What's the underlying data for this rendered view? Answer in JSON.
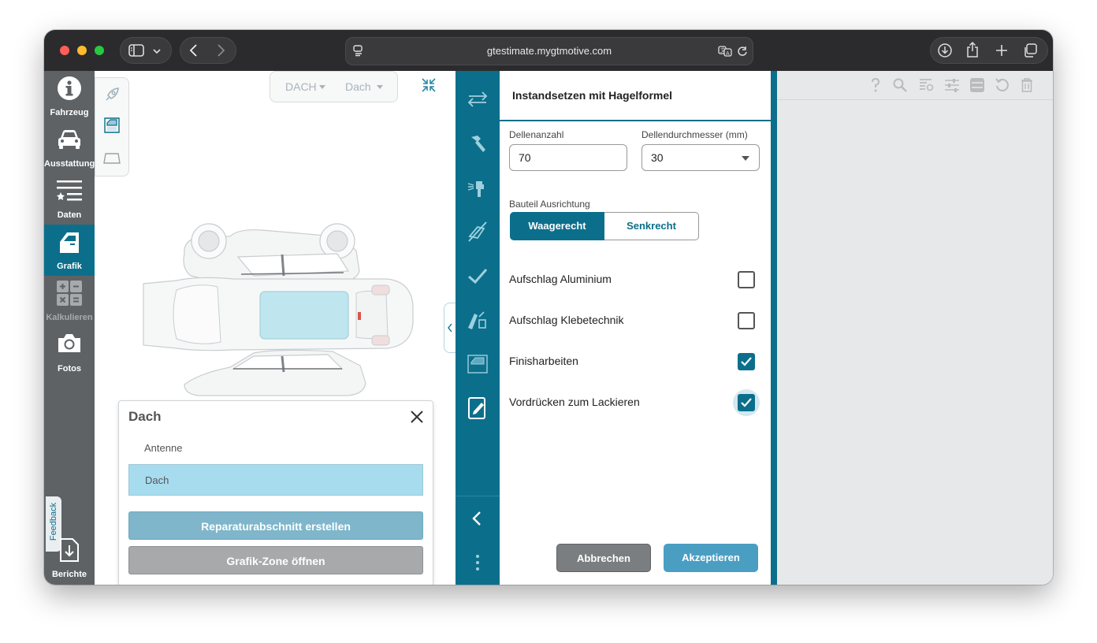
{
  "browser": {
    "url": "gtestimate.mygtmotive.com",
    "icons": [
      "sidebar-icon",
      "chevron-down-icon",
      "back-icon",
      "forward-icon",
      "site-settings-icon",
      "translate-icon",
      "reload-icon",
      "download-icon",
      "share-icon",
      "new-tab-icon",
      "tabs-overview-icon"
    ]
  },
  "left_sidebar": {
    "items": [
      {
        "label": "Fahrzeug",
        "icon": "info-icon"
      },
      {
        "label": "Ausstattung",
        "icon": "car-icon"
      },
      {
        "label": "Daten",
        "icon": "list-star-icon"
      },
      {
        "label": "Grafik",
        "icon": "door-icon"
      },
      {
        "label": "Kalkulieren",
        "icon": "calculator-icon"
      },
      {
        "label": "Fotos",
        "icon": "camera-icon"
      }
    ],
    "feedback": "Feedback",
    "reports": "Berichte"
  },
  "canvas": {
    "dropdown_zone": "DACH",
    "dropdown_part": "Dach"
  },
  "popup": {
    "title": "Dach",
    "options": [
      "Antenne",
      "Dach"
    ],
    "selected_option": "Dach",
    "create_button": "Reparaturabschnitt erstellen",
    "open_zone_button": "Grafik-Zone öffnen"
  },
  "form": {
    "title": "Instandsetzen mit Hagelformel",
    "dent_count_label": "Dellenanzahl",
    "dent_count_value": "70",
    "dent_diameter_label": "Dellendurchmesser (mm)",
    "dent_diameter_value": "30",
    "orientation_label": "Bauteil Ausrichtung",
    "orientation_options": [
      "Waagerecht",
      "Senkrecht"
    ],
    "orientation_selected": "Waagerecht",
    "checkboxes": [
      {
        "label": "Aufschlag Aluminium",
        "checked": false
      },
      {
        "label": "Aufschlag Klebetechnik",
        "checked": false
      },
      {
        "label": "Finisharbeiten",
        "checked": true
      },
      {
        "label": "Vordrücken zum Lackieren",
        "checked": true
      }
    ],
    "cancel_button": "Abbrechen",
    "accept_button": "Akzeptieren"
  },
  "colors": {
    "teal": "#0b6f8b",
    "sidebar_gray": "#5f6265",
    "selected_row": "#a7dcef",
    "accept_blue": "#4a9ec2",
    "cancel_gray": "#7b7e81"
  }
}
